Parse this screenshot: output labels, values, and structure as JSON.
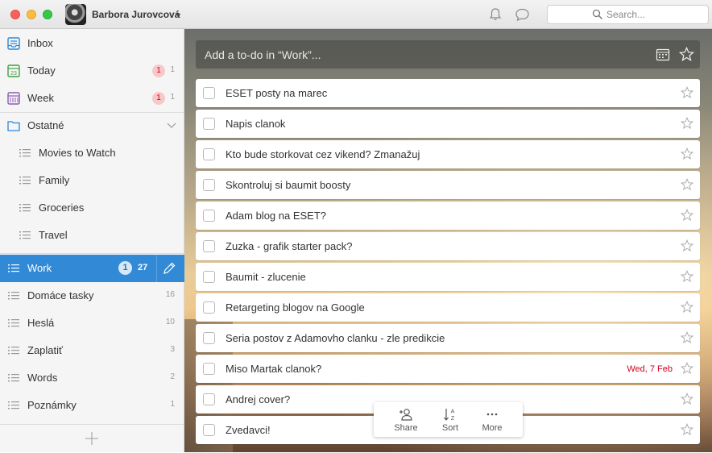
{
  "titlebar": {
    "username": "Barbora Jurovcová",
    "search_placeholder": "Search..."
  },
  "sidebar": {
    "smart_lists": [
      {
        "label": "Inbox",
        "icon": "inbox-icon"
      },
      {
        "label": "Today",
        "icon": "calendar-today-icon",
        "icon_text": "23",
        "badge": "1",
        "count": "1"
      },
      {
        "label": "Week",
        "icon": "calendar-week-icon",
        "badge": "1",
        "count": "1"
      }
    ],
    "folder": {
      "label": "Ostatné",
      "icon": "folder-icon"
    },
    "folder_lists": [
      "Movies to Watch",
      "Family",
      "Groceries",
      "Travel"
    ],
    "active_list": {
      "label": "Work",
      "badge": "1",
      "count": "27"
    },
    "lists": [
      {
        "label": "Domáce tasky",
        "count": "16"
      },
      {
        "label": "Heslá",
        "count": "10"
      },
      {
        "label": "Zaplatiť",
        "count": "3"
      },
      {
        "label": "Words",
        "count": "2"
      },
      {
        "label": "Poznámky",
        "count": "1"
      }
    ]
  },
  "main": {
    "add_placeholder": "Add a to-do in “Work”...",
    "tasks": [
      {
        "title": "ESET posty na marec",
        "due": ""
      },
      {
        "title": "Napis clanok",
        "due": ""
      },
      {
        "title": "Kto bude storkovat cez vikend? Zmanažuj",
        "due": ""
      },
      {
        "title": "Skontroluj si baumit boosty",
        "due": ""
      },
      {
        "title": "Adam blog na ESET?",
        "due": ""
      },
      {
        "title": "Zuzka - grafik starter pack?",
        "due": ""
      },
      {
        "title": "Baumit - zlucenie",
        "due": ""
      },
      {
        "title": "Retargeting blogov na Google",
        "due": ""
      },
      {
        "title": "Seria postov z Adamovho clanku - zle predikcie",
        "due": ""
      },
      {
        "title": "Miso Martak clanok?",
        "due": "Wed, 7 Feb"
      },
      {
        "title": "Andrej cover?",
        "due": ""
      },
      {
        "title": "Zvedavci!",
        "due": ""
      }
    ]
  },
  "toolbar": {
    "share": "Share",
    "sort": "Sort",
    "more": "More"
  },
  "colors": {
    "accent": "#328ad6",
    "badge_red": "#d0021b",
    "due_red": "#d0021b"
  }
}
